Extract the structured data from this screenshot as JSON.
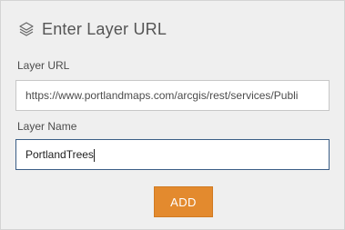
{
  "header": {
    "title": "Enter Layer URL",
    "icon": "layers-icon"
  },
  "layer_url": {
    "label": "Layer URL",
    "value": "https://www.portlandmaps.com/arcgis/rest/services/Publi"
  },
  "layer_name": {
    "label": "Layer Name",
    "value": "PortlandTrees"
  },
  "add_button": {
    "label": "ADD"
  },
  "colors": {
    "accent": "#e38a2e",
    "focus_border": "#3b5e86",
    "panel_bg": "#efefef"
  }
}
